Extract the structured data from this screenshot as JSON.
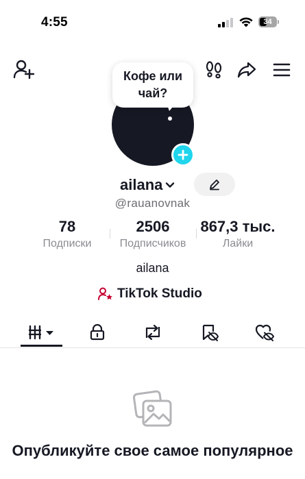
{
  "status_bar": {
    "time": "4:55",
    "battery": "34"
  },
  "speech_bubble": {
    "text": "Кофе или чай?"
  },
  "profile": {
    "username": "ailana",
    "handle": "@rauanovnak",
    "bio": "ailana"
  },
  "stats": [
    {
      "value": "78",
      "label": "Подписки"
    },
    {
      "value": "2506",
      "label": "Подписчиков"
    },
    {
      "value": "867,3 тыс.",
      "label": "Лайки"
    }
  ],
  "studio_link": {
    "label": "TikTok Studio"
  },
  "tabs": [
    {
      "icon": "videos-grid-icon",
      "active": true
    },
    {
      "icon": "lock-icon"
    },
    {
      "icon": "repost-icon"
    },
    {
      "icon": "favorites-icon"
    },
    {
      "icon": "liked-icon"
    }
  ],
  "empty_state": {
    "title": "Опубликуйте свое самое популярное"
  },
  "colors": {
    "accent": "#20d5ec",
    "studio": "#c4002f",
    "text": "#161823"
  }
}
